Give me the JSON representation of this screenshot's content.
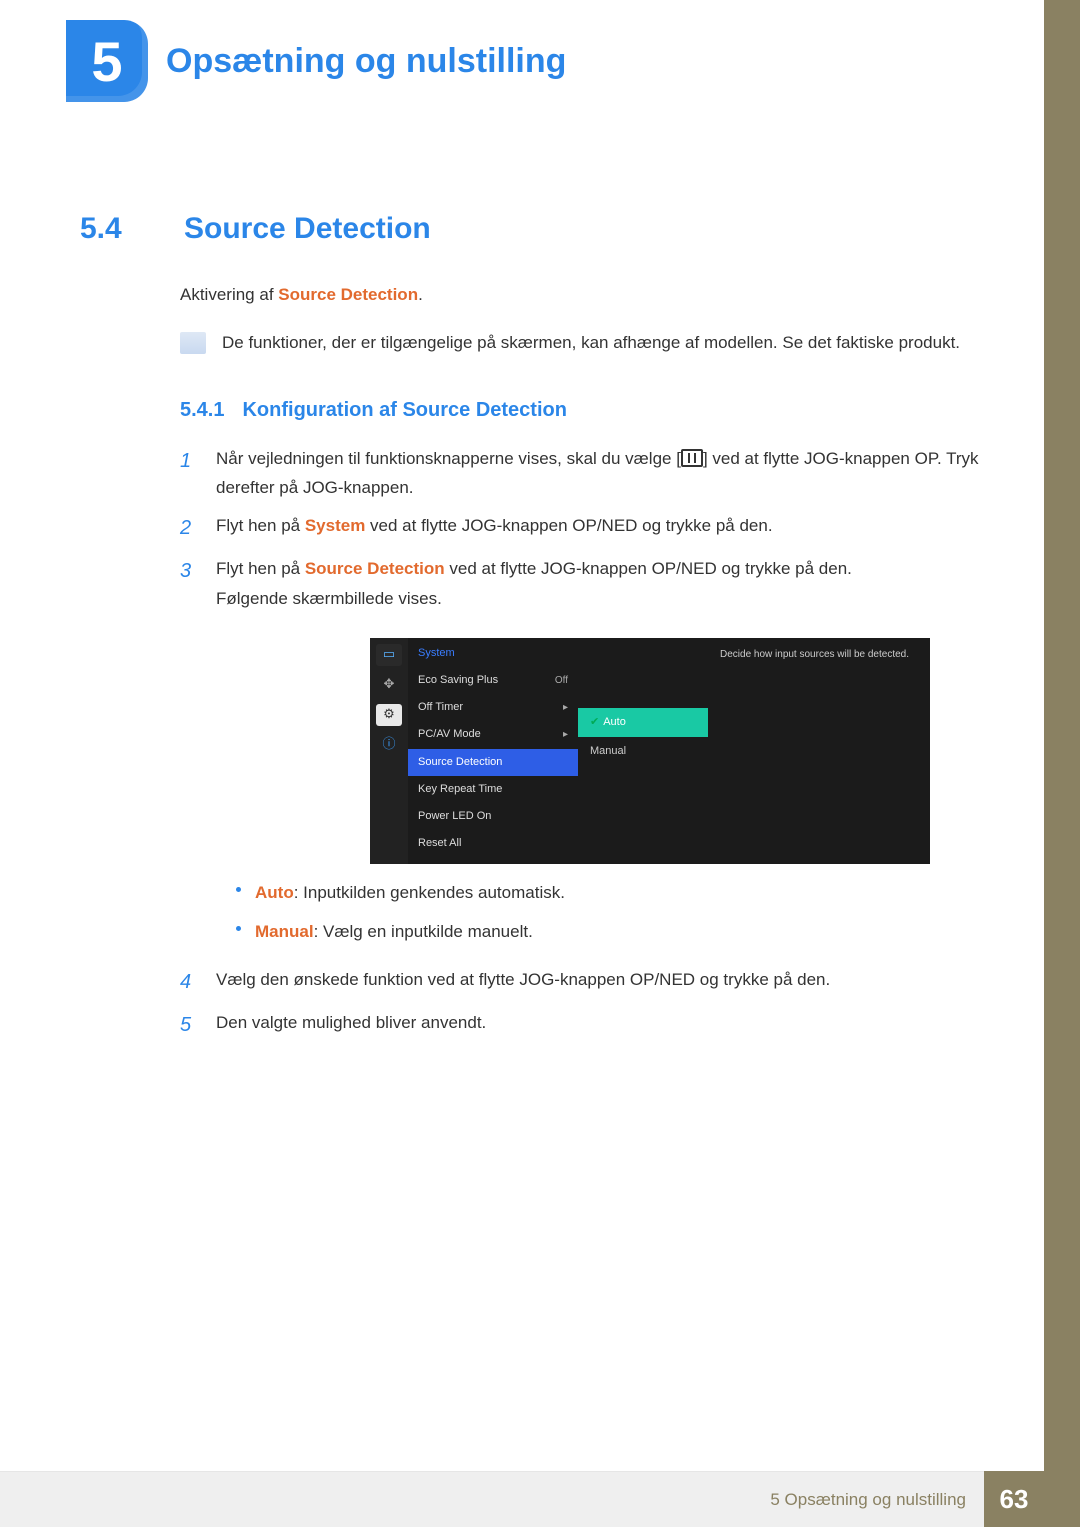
{
  "chapter": {
    "number": "5",
    "title": "Opsætning og nulstilling"
  },
  "section": {
    "number": "5.4",
    "title": "Source Detection"
  },
  "activation": {
    "prefix": "Aktivering af ",
    "feature": "Source Detection",
    "suffix": "."
  },
  "note": "De funktioner, der er tilgængelige på skærmen, kan afhænge af modellen. Se det faktiske produkt.",
  "subsection": {
    "number": "5.4.1",
    "title": "Konfiguration af Source Detection"
  },
  "steps": {
    "s1a": "Når vejledningen til funktionsknapperne vises, skal du vælge [",
    "s1b": "] ved at flytte JOG-knappen OP. Tryk derefter på JOG-knappen.",
    "s2a": "Flyt hen på ",
    "s2_hl": "System",
    "s2b": " ved at flytte JOG-knappen OP/NED og trykke på den.",
    "s3a": "Flyt hen på ",
    "s3_hl": "Source Detection",
    "s3b": " ved at flytte JOG-knappen OP/NED og trykke på den.",
    "s3c": "Følgende skærmbillede vises.",
    "s4": "Vælg den ønskede funktion ved at flytte JOG-knappen OP/NED og trykke på den.",
    "s5": "Den valgte mulighed bliver anvendt."
  },
  "step_numbers": {
    "n1": "1",
    "n2": "2",
    "n3": "3",
    "n4": "4",
    "n5": "5"
  },
  "osd": {
    "title": "System",
    "items": {
      "eco": "Eco Saving Plus",
      "eco_val": "Off",
      "offtimer": "Off Timer",
      "pcav": "PC/AV Mode",
      "source": "Source Detection",
      "keyrepeat": "Key Repeat Time",
      "powerled": "Power LED On",
      "resetall": "Reset All"
    },
    "submenu": {
      "auto": "Auto",
      "manual": "Manual"
    },
    "desc": "Decide how input sources will be detected.",
    "arrow": "▸"
  },
  "options": {
    "auto_label": "Auto",
    "auto_text": ": Inputkilden genkendes automatisk.",
    "manual_label": "Manual",
    "manual_text": ": Vælg en inputkilde manuelt."
  },
  "footer": {
    "text": "5 Opsætning og nulstilling",
    "page": "63"
  }
}
